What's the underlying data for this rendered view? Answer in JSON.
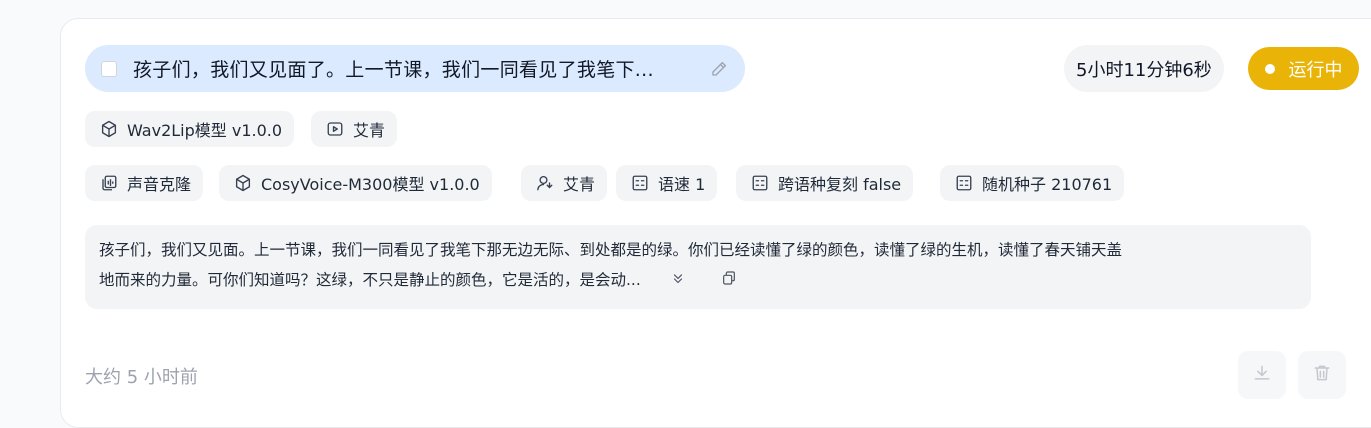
{
  "task": {
    "title": "孩子们，我们又见面了。上一节课，我们一同看见了我笔下...",
    "duration": "5小时11分钟6秒",
    "status": "运行中",
    "status_color": "#eab308"
  },
  "video_tags": [
    {
      "icon": "cube-icon",
      "label": "Wav2Lip模型 v1.0.0"
    },
    {
      "icon": "video-icon",
      "label": "艾青"
    }
  ],
  "voice_tags": [
    {
      "icon": "voice-clone-icon",
      "label": "声音克隆"
    },
    {
      "icon": "cube-icon",
      "label": "CosyVoice-M300模型 v1.0.0"
    },
    {
      "icon": "user-voice-icon",
      "label": "艾青"
    },
    {
      "icon": "param-icon",
      "label": "语速 1"
    },
    {
      "icon": "param-icon",
      "label": "跨语种复刻 false"
    },
    {
      "icon": "param-icon",
      "label": "随机种子 210761"
    }
  ],
  "description": {
    "line1": "孩子们，我们又见面。上一节课，我们一同看见了我笔下那无边无际、到处都是的绿。你们已经读懂了绿的颜色，读懂了绿的生机，读懂了春天铺天盖",
    "line2": "地而来的力量。可你们知道吗？这绿，不只是静止的颜色，它是活的，是会动..."
  },
  "footer": {
    "time_ago": "大约 5 小时前"
  }
}
